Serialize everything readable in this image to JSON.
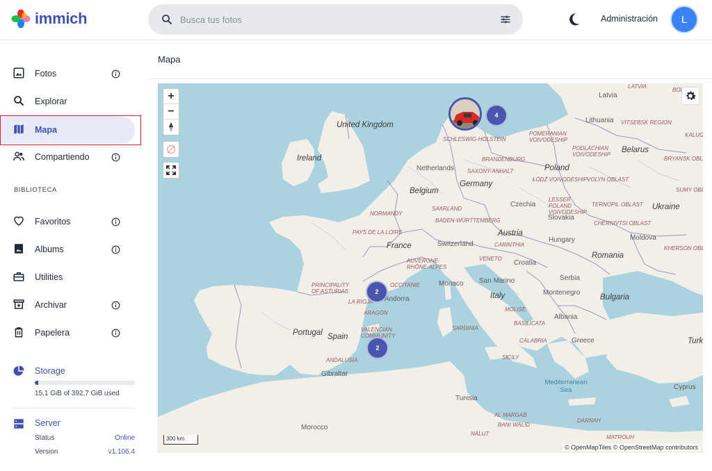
{
  "app": {
    "name": "immich"
  },
  "header": {
    "search_placeholder": "Busca tus fotos",
    "admin_label": "Administración",
    "avatar_initial": "L"
  },
  "sidebar": {
    "items": [
      {
        "label": "Fotos"
      },
      {
        "label": "Explorar"
      },
      {
        "label": "Mapa"
      },
      {
        "label": "Compartiendo"
      }
    ],
    "section_label": "BIBLIOTECA",
    "library_items": [
      {
        "label": "Favoritos"
      },
      {
        "label": "Albums"
      },
      {
        "label": "Utilities"
      },
      {
        "label": "Archivar"
      },
      {
        "label": "Papelera"
      }
    ],
    "storage": {
      "title": "Storage",
      "usage_text": "15,1 GiB of 392,7 GiB used",
      "fraction_used": 0.038
    },
    "server": {
      "title": "Server",
      "status_label": "Status",
      "status_value": "Online",
      "version_label": "Version",
      "version_value": "v1.106.4"
    }
  },
  "main": {
    "title": "Mapa"
  },
  "map": {
    "zoom_in": "+",
    "zoom_out": "−",
    "scale_label": "300 km",
    "attribution": "© OpenMapTiles © OpenStreetMap contributors",
    "clusters": [
      {
        "count": "4"
      },
      {
        "count": "2"
      },
      {
        "count": "2"
      }
    ],
    "labels": {
      "uk": "United Kingdom",
      "ireland": "Ireland",
      "netherlands": "Netherlands",
      "belgium": "Belgium",
      "germany": "Germany",
      "france": "France",
      "switzerland": "Switzerland",
      "austria": "Austria",
      "czechia": "Czechia",
      "poland": "Poland",
      "lithuania": "Lithuania",
      "latvia": "Latvia",
      "belarus": "Belarus",
      "ukraine": "Ukraine",
      "slovakia": "Slovakia",
      "hungary": "Hungary",
      "moldova": "Moldova",
      "romania": "Romania",
      "croatia": "Croatia",
      "serbia": "Serbia",
      "montenegro": "Montenegro",
      "bulgaria": "Bulgaria",
      "albania": "Albania",
      "greece": "Greece",
      "turkey": "Turk",
      "italy": "Italy",
      "sanmarino": "San Marino",
      "monaco": "Monaco",
      "andorra": "Andorra",
      "portugal": "Portugal",
      "spain": "Spain",
      "gibraltar": "Gibraltar",
      "morocco": "Morocco",
      "tunisia": "Tunisia",
      "cyprus": "Cyprus",
      "sea": "Mediterranean Sea",
      "r_latvia": "LATVIA",
      "r_vitsebsk": "VITSEBSK REGION",
      "r_kaluga": "KALUGA",
      "r_bryansk": "BRYANSK OBLAST",
      "r_sumy": "SUMY OBL",
      "r_kherson": "KHERSON OBLA",
      "r_schleswig": "SCHLESWIG-HOLSTEIN",
      "r_pomeranian": "POMERANIAN VOIVODESHIP",
      "r_podlachian": "PODLACHIAN VOIVODESHIP",
      "r_brandenburg": "BRANDENBURG",
      "r_saxony": "SAXONY-ANHALT",
      "r_lodz": "ŁÓDŹ VOIVODESHIP",
      "r_volyn": "VOLYN OBLAST",
      "r_lesser": "LESSER POLAND VOIVODESHIP",
      "r_ternopil": "TERNOPIL OBLAST",
      "r_chernivtsi": "CHERNIVTSI OBLAST",
      "r_saarland": "SAARLAND",
      "r_badenw": "BADEN-WÜRTTEMBERG",
      "r_normandy": "NORMANDY",
      "r_paysloire": "PAYS DE LA LOIRE",
      "r_auvergne": "AUVERGNE-RHÔNE-ALPES",
      "r_carinthia": "CARINTHIA",
      "r_veneto": "VENETO",
      "r_occitanie": "OCCITANIE",
      "r_asturias": "PRINCIPALITY OF ASTURIAS",
      "r_rioja": "LA RIOJA",
      "r_aragon": "ARAGON",
      "r_valencia": "VALENCIAN COMMUNITY",
      "r_andalusia": "ANDALUSIA",
      "r_molise": "MOLISE",
      "r_basilicata": "BASILICATA",
      "r_calabria": "CALABRIA",
      "r_sardinia": "SARDINIA",
      "r_sicily": "SICILY",
      "r_margab": "AL MARGAB",
      "r_baniwalid": "BANI WALID",
      "r_nalut": "NALUT",
      "r_darnah": "DARNAH",
      "r_matrouh": "MATROUH",
      "r_boblast": "BOBLAST"
    }
  },
  "colors": {
    "accent": "#4250af",
    "sea": "#aad3df",
    "land": "#f2efe9",
    "border": "#8b7fb8",
    "cluster": "#4a56ad"
  }
}
